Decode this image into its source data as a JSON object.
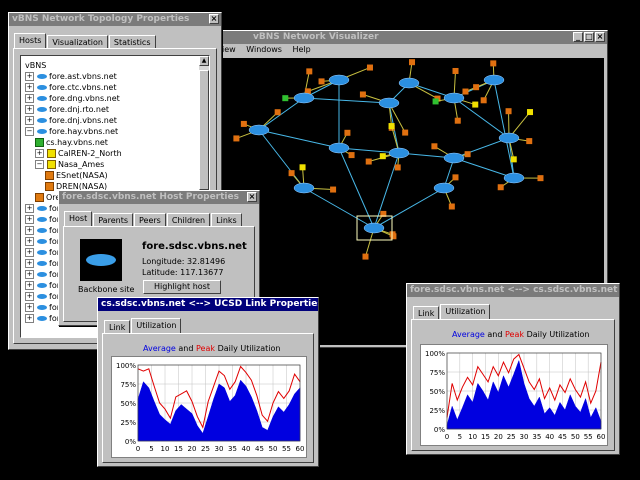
{
  "topology": {
    "title": "vBNS Network Topology Properties",
    "tabs": [
      "Hosts",
      "Visualization",
      "Statistics"
    ],
    "tree": [
      {
        "label": "vBNS",
        "icon": "none",
        "expander": ""
      },
      {
        "label": "fore.ast.vbns.net",
        "icon": "oval",
        "expander": "+"
      },
      {
        "label": "fore.ctc.vbns.net",
        "icon": "oval",
        "expander": "+"
      },
      {
        "label": "fore.dng.vbns.net",
        "icon": "oval",
        "expander": "+"
      },
      {
        "label": "fore.dnj.rto.net",
        "icon": "oval",
        "expander": "+"
      },
      {
        "label": "fore.dnj.vbns.net",
        "icon": "oval",
        "expander": "+"
      },
      {
        "label": "fore.hay.vbns.net",
        "icon": "oval",
        "expander": "−"
      },
      {
        "label": "cs.hay.vbns.net",
        "icon": "cube-g",
        "expander": ""
      },
      {
        "label": "CalREN-2_North",
        "icon": "cube-y",
        "expander": "+"
      },
      {
        "label": "Nasa_Ames",
        "icon": "cube-y",
        "expander": "−"
      },
      {
        "label": "ESnet(NASA)",
        "icon": "cube-o",
        "expander": ""
      },
      {
        "label": "DREN(NASA)",
        "icon": "cube-o",
        "expander": ""
      },
      {
        "label": "Oregan_State",
        "icon": "cube-o",
        "expander": ""
      },
      {
        "label": "fore",
        "icon": "oval",
        "expander": "+"
      },
      {
        "label": "fore",
        "icon": "oval",
        "expander": "+"
      },
      {
        "label": "fore",
        "icon": "oval",
        "expander": "+"
      },
      {
        "label": "fore",
        "icon": "oval",
        "expander": "+"
      },
      {
        "label": "fore",
        "icon": "oval",
        "expander": "+"
      },
      {
        "label": "fore",
        "icon": "oval",
        "expander": "+"
      },
      {
        "label": "fore",
        "icon": "oval",
        "expander": "+"
      },
      {
        "label": "fore",
        "icon": "oval",
        "expander": "+"
      },
      {
        "label": "fore",
        "icon": "oval",
        "expander": "+"
      },
      {
        "label": "fore",
        "icon": "oval",
        "expander": "+"
      },
      {
        "label": "fore",
        "icon": "oval",
        "expander": "+"
      }
    ]
  },
  "visualizer": {
    "title": "vBNS Network Visualizer",
    "menu": [
      "iew",
      "Windows",
      "Help"
    ]
  },
  "host": {
    "title": "fore.sdsc.vbns.net Host Properties",
    "tabs": [
      "Host",
      "Parents",
      "Peers",
      "Children",
      "Links"
    ],
    "name": "fore.sdsc.vbns.net",
    "longitude": "Longitude:  32.81496",
    "latitude": "Latitude:  117.13677",
    "button": "Highlight host",
    "icon_caption": "Backbone site"
  },
  "link1": {
    "title": "cs.sdsc.vbns.net <--> UCSD Link Properties",
    "tabs": [
      "Link",
      "Utilization"
    ],
    "heading_avg": "Average",
    "heading_and": "and",
    "heading_peak": "Peak",
    "heading_rest": "Daily Utilization",
    "yticks": [
      "100%",
      "75%",
      "50%",
      "25%",
      "0%"
    ],
    "xticks": [
      "0",
      "5",
      "10",
      "15",
      "20",
      "25",
      "30",
      "35",
      "40",
      "45",
      "50",
      "55",
      "60"
    ]
  },
  "link2": {
    "title": "fore.sdsc.vbns.net <--> cs.sdsc.vbns.net Link Properties",
    "tabs": [
      "Link",
      "Utilization"
    ],
    "heading_avg": "Average",
    "heading_and": "and",
    "heading_peak": "Peak",
    "heading_rest": "Daily Utilization",
    "yticks": [
      "100%",
      "75%",
      "50%",
      "25%",
      "0%"
    ],
    "xticks": [
      "0",
      "5",
      "10",
      "15",
      "20",
      "25",
      "30",
      "35",
      "40",
      "45",
      "50",
      "55",
      "60"
    ]
  },
  "colors": {
    "average": "#0000e0",
    "peak": "#e00000",
    "title_active": "#00007b",
    "title_inactive": "#7b7b7b"
  },
  "chart_data": [
    {
      "type": "area",
      "title": "Average and Peak Daily Utilization",
      "x": [
        0,
        2,
        4,
        6,
        8,
        10,
        12,
        14,
        16,
        18,
        20,
        22,
        24,
        26,
        28,
        30,
        32,
        34,
        36,
        38,
        40,
        42,
        44,
        46,
        48,
        50,
        52,
        54,
        56,
        58,
        60
      ],
      "ylim": [
        0,
        100
      ],
      "xlim": [
        0,
        60
      ],
      "series": [
        {
          "name": "Average",
          "values": [
            55,
            78,
            70,
            52,
            35,
            28,
            22,
            40,
            48,
            42,
            36,
            20,
            10,
            32,
            55,
            75,
            70,
            52,
            60,
            80,
            72,
            58,
            40,
            18,
            14,
            32,
            45,
            38,
            48,
            62,
            70
          ]
        },
        {
          "name": "Peak",
          "values": [
            95,
            92,
            95,
            72,
            50,
            42,
            30,
            58,
            62,
            66,
            52,
            32,
            18,
            52,
            72,
            92,
            86,
            68,
            78,
            98,
            90,
            80,
            60,
            34,
            26,
            50,
            65,
            56,
            66,
            88,
            78
          ]
        }
      ]
    },
    {
      "type": "area",
      "title": "Average and Peak Daily Utilization",
      "x": [
        0,
        2,
        4,
        6,
        8,
        10,
        12,
        14,
        16,
        18,
        20,
        22,
        24,
        26,
        28,
        30,
        32,
        34,
        36,
        38,
        40,
        42,
        44,
        46,
        48,
        50,
        52,
        54,
        56,
        58,
        60
      ],
      "ylim": [
        0,
        100
      ],
      "xlim": [
        0,
        60
      ],
      "series": [
        {
          "name": "Average",
          "values": [
            5,
            30,
            12,
            28,
            45,
            35,
            60,
            50,
            38,
            62,
            48,
            70,
            55,
            72,
            90,
            60,
            40,
            30,
            42,
            20,
            28,
            18,
            35,
            25,
            45,
            30,
            22,
            40,
            15,
            28,
            10
          ]
        },
        {
          "name": "Peak",
          "values": [
            15,
            60,
            38,
            55,
            68,
            58,
            82,
            72,
            62,
            82,
            70,
            88,
            74,
            92,
            98,
            80,
            62,
            52,
            66,
            40,
            54,
            38,
            58,
            48,
            66,
            52,
            42,
            62,
            34,
            50,
            88
          ]
        }
      ]
    }
  ]
}
